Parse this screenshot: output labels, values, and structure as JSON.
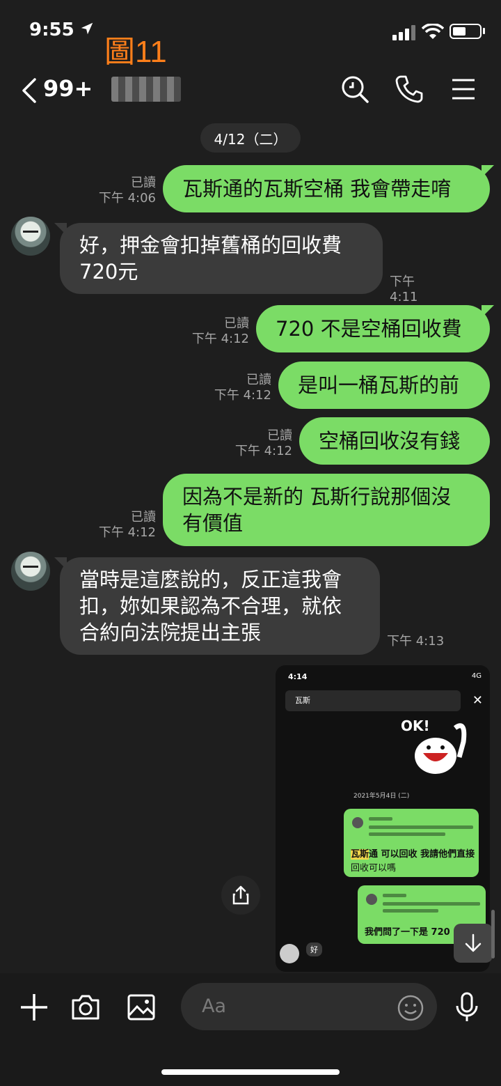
{
  "status_bar": {
    "time": "9:55",
    "figure_label": "圖11"
  },
  "header": {
    "unread_count": "99+"
  },
  "date_pill": "4/12（二）",
  "read_label": "已讀",
  "messages": [
    {
      "text": "瓦斯通的瓦斯空桶 我會帶走唷",
      "time": "下午 4:06"
    },
    {
      "text": "好，押金會扣掉舊桶的回收費720元",
      "line1": "好，押金會扣掉舊桶的回收費",
      "line2": "720元",
      "time": "下午 4:11"
    },
    {
      "text": "720 不是空桶回收費",
      "time": "下午 4:12"
    },
    {
      "text": "是叫一桶瓦斯的前",
      "time": "下午 4:12"
    },
    {
      "text": "空桶回收沒有錢",
      "time": "下午 4:12"
    },
    {
      "line1": "因為不是新的 瓦斯行說那個沒",
      "line2": "有價值",
      "time": "下午 4:12"
    },
    {
      "line1": "當時是這麼說的，反正這我會",
      "line2": "扣，妳如果認為不合理，就依",
      "line3": "合約向法院提出主張",
      "time": "下午 4:13"
    }
  ],
  "screenshot": {
    "time": "4:14",
    "status": "4G",
    "search_text": "瓦斯",
    "date": "2021年5月4日 (二)",
    "bubble1_highlight": "瓦斯",
    "bubble1_text": "通 可以回收 我請他們直接",
    "bubble1_text2": "回收可以嗎",
    "bubble2_text": "我們問了一下是 720",
    "reply": "好",
    "sticker_text": "OK!"
  },
  "input": {
    "placeholder": "Aa"
  },
  "colors": {
    "background": "#1e1e1e",
    "outgoing_bubble": "#7bdc66",
    "incoming_bubble": "#3b3b3b",
    "figure_label": "#ff7f1a"
  },
  "icons": [
    "location-arrow-icon",
    "signal-icon",
    "wifi-icon",
    "battery-icon",
    "back-chevron-icon",
    "search-icon",
    "phone-icon",
    "menu-icon",
    "share-icon",
    "down-arrow-icon",
    "plus-icon",
    "camera-icon",
    "image-icon",
    "emoji-icon",
    "microphone-icon"
  ]
}
